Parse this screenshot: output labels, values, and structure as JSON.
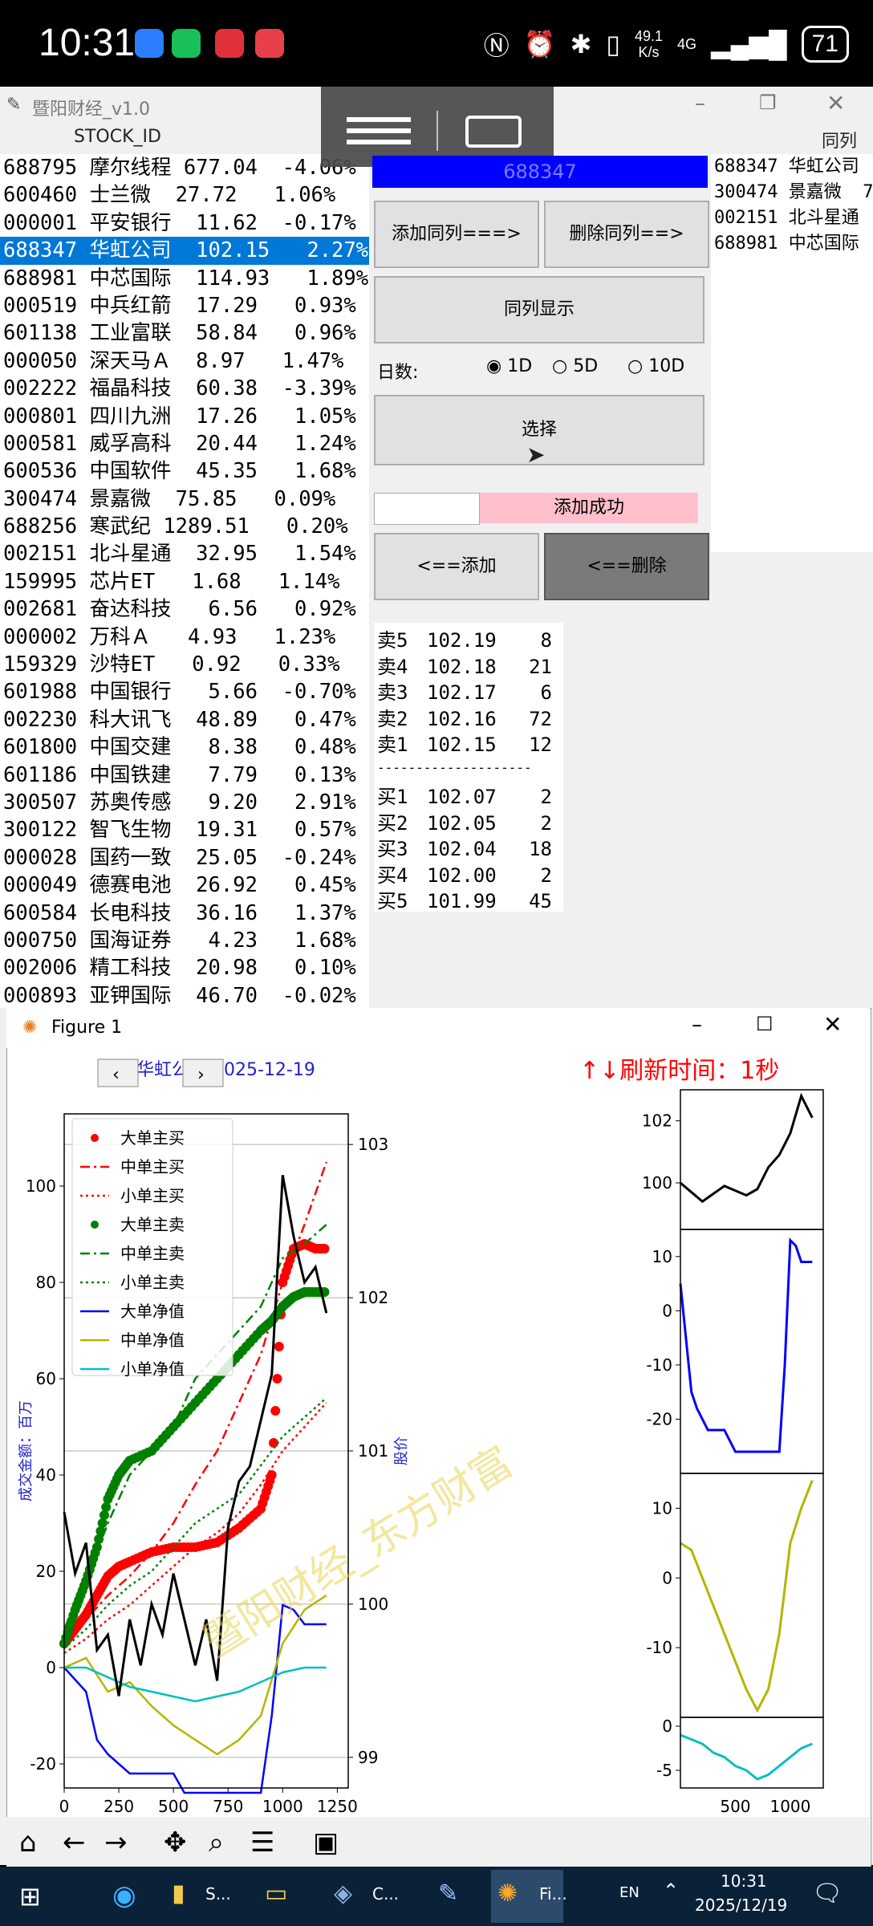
{
  "status_bar": {
    "time": "10:31",
    "net_speed_value": "49.1",
    "net_speed_unit": "K/s",
    "network_type": "4G",
    "battery": "71"
  },
  "app_window": {
    "title": "暨阳财经_v1.0",
    "col_stock_id": "STOCK_ID",
    "col_peer": "同列列"
  },
  "stock_list": [
    {
      "text": "688795 摩尔线程 677.04  -4.06%"
    },
    {
      "text": "600460 士兰微  27.72   1.06%"
    },
    {
      "text": "000001 平安银行  11.62  -0.17%"
    },
    {
      "text": "688347 华虹公司  102.15   2.27%"
    },
    {
      "text": "688981 中芯国际  114.93   1.89%"
    },
    {
      "text": "000519 中兵红箭  17.29   0.93%"
    },
    {
      "text": "601138 工业富联  58.84   0.96%"
    },
    {
      "text": "000050 深天马Ａ  8.97   1.47%"
    },
    {
      "text": "002222 福晶科技  60.38  -3.39%"
    },
    {
      "text": "000801 四川九洲  17.26   1.05%"
    },
    {
      "text": "000581 威孚高科  20.44   1.24%"
    },
    {
      "text": "600536 中国软件  45.35   1.68%"
    },
    {
      "text": "300474 景嘉微  75.85   0.09%"
    },
    {
      "text": "688256 寒武纪 1289.51   0.20%"
    },
    {
      "text": "002151 北斗星通  32.95   1.54%"
    },
    {
      "text": "159995 芯片ET   1.68   1.14%"
    },
    {
      "text": "002681 奋达科技   6.56   0.92%"
    },
    {
      "text": "000002 万科Ａ   4.93   1.23%"
    },
    {
      "text": "159329 沙特ET   0.92   0.33%"
    },
    {
      "text": "601988 中国银行   5.66  -0.70%"
    },
    {
      "text": "002230 科大讯飞  48.89   0.47%"
    },
    {
      "text": "601800 中国交建   8.38   0.48%"
    },
    {
      "text": "601186 中国铁建   7.79   0.13%"
    },
    {
      "text": "300507 苏奥传感   9.20   2.91%"
    },
    {
      "text": "300122 智飞生物  19.31   0.57%"
    },
    {
      "text": "000028 国药一致  25.05  -0.24%"
    },
    {
      "text": "000049 德赛电池  26.92   0.45%"
    },
    {
      "text": "600584 长电科技  36.16   1.37%"
    },
    {
      "text": "000750 国海证券   4.23   1.68%"
    },
    {
      "text": "002006 精工科技  20.98   0.10%"
    },
    {
      "text": "000893 亚钾国际  46.70  -0.02%"
    }
  ],
  "controls": {
    "code": "688347",
    "add_peer": "添加同列===>",
    "del_peer": "删除同列==>",
    "show_peer": "同列显示",
    "days_label": "日数:",
    "opt_1d": "1D",
    "opt_5d": "5D",
    "opt_10d": "10D",
    "select": "选择",
    "status": "添加成功",
    "add": "<==添加",
    "delete": "<==删除"
  },
  "peer_list": [
    "688347 华虹公司",
    "300474 景嘉微  7",
    "002151 北斗星通",
    "688981 中芯国际"
  ],
  "order_book": {
    "asks": [
      {
        "label": "卖5",
        "price": "102.19",
        "vol": "8"
      },
      {
        "label": "卖4",
        "price": "102.18",
        "vol": "21"
      },
      {
        "label": "卖3",
        "price": "102.17",
        "vol": "6"
      },
      {
        "label": "卖2",
        "price": "102.16",
        "vol": "72"
      },
      {
        "label": "卖1",
        "price": "102.15",
        "vol": "12"
      }
    ],
    "divider": "--------------------",
    "bids": [
      {
        "label": "买1",
        "price": "102.07",
        "vol": "2"
      },
      {
        "label": "买2",
        "price": "102.05",
        "vol": "2"
      },
      {
        "label": "买3",
        "price": "102.04",
        "vol": "18"
      },
      {
        "label": "买4",
        "price": "102.00",
        "vol": "2"
      },
      {
        "label": "买5",
        "price": "101.99",
        "vol": "45"
      }
    ]
  },
  "figure": {
    "window_title": "Figure 1",
    "chart_title": "华虹公司  2025-12-19",
    "refresh": "↑↓刷新时间：1秒",
    "watermark": "暨阳财经_东方财富"
  },
  "chart_data": [
    {
      "type": "line",
      "title": "华虹公司  2025-12-19",
      "ylabel": "成交金额：百万",
      "y2label": "股价",
      "xlim": [
        0,
        1300
      ],
      "ylim": [
        -25,
        115
      ],
      "y2lim": [
        98.8,
        103.2
      ],
      "xticks": [
        "0",
        "250",
        "500",
        "750",
        "1000",
        "1250"
      ],
      "yticks": [
        "-20",
        "0",
        "20",
        "40",
        "60",
        "80",
        "100"
      ],
      "y2ticks": [
        "99",
        "100",
        "101",
        "102",
        "103"
      ],
      "legend_placement": "top-left",
      "grid": "horizontal on price axis",
      "series": [
        {
          "name": "大单主买",
          "color": "#ff0000",
          "style": "dots",
          "x": [
            0,
            50,
            100,
            150,
            200,
            250,
            300,
            400,
            500,
            600,
            700,
            800,
            900,
            950,
            1000,
            1050,
            1100,
            1150,
            1200
          ],
          "values": [
            5,
            8,
            11,
            15,
            19,
            21,
            22,
            24,
            25,
            25,
            26,
            29,
            33,
            40,
            80,
            87,
            88,
            87,
            87
          ]
        },
        {
          "name": "中单主买",
          "color": "#ff0000",
          "style": "dashdot",
          "x": [
            0,
            100,
            200,
            300,
            400,
            500,
            600,
            700,
            800,
            900,
            1000,
            1100,
            1200
          ],
          "values": [
            5,
            10,
            15,
            19,
            24,
            30,
            38,
            45,
            55,
            65,
            80,
            92,
            105
          ]
        },
        {
          "name": "小单主买",
          "color": "#ff0000",
          "style": "dotted",
          "x": [
            0,
            100,
            200,
            300,
            400,
            500,
            600,
            700,
            800,
            900,
            1000,
            1100,
            1200
          ],
          "values": [
            3,
            6,
            10,
            13,
            17,
            21,
            25,
            28,
            32,
            38,
            45,
            50,
            55
          ]
        },
        {
          "name": "大单主卖",
          "color": "#008000",
          "style": "dots",
          "x": [
            0,
            50,
            100,
            150,
            200,
            250,
            300,
            400,
            500,
            600,
            700,
            800,
            900,
            950,
            1000,
            1050,
            1100,
            1150,
            1200
          ],
          "values": [
            5,
            12,
            18,
            25,
            35,
            40,
            43,
            45,
            50,
            55,
            60,
            65,
            70,
            72,
            75,
            77,
            78,
            78,
            78
          ]
        },
        {
          "name": "中单主卖",
          "color": "#008000",
          "style": "dashdot",
          "x": [
            0,
            100,
            200,
            300,
            400,
            500,
            600,
            700,
            800,
            900,
            1000,
            1100,
            1200
          ],
          "values": [
            8,
            18,
            30,
            40,
            45,
            50,
            60,
            65,
            70,
            75,
            85,
            88,
            92
          ]
        },
        {
          "name": "小单主卖",
          "color": "#008000",
          "style": "dotted",
          "x": [
            0,
            100,
            200,
            300,
            400,
            500,
            600,
            700,
            800,
            900,
            1000,
            1100,
            1200
          ],
          "values": [
            4,
            8,
            13,
            17,
            20,
            25,
            30,
            33,
            36,
            42,
            48,
            52,
            56
          ]
        },
        {
          "name": "大单净值",
          "color": "#0000ff",
          "style": "solid",
          "x": [
            0,
            100,
            150,
            200,
            250,
            300,
            400,
            500,
            550,
            600,
            700,
            800,
            900,
            950,
            1000,
            1050,
            1100,
            1150,
            1200
          ],
          "values": [
            0,
            -5,
            -15,
            -18,
            -20,
            -22,
            -22,
            -22,
            -26,
            -26,
            -26,
            -26,
            -26,
            -10,
            13,
            12,
            9,
            9,
            9
          ]
        },
        {
          "name": "中单净值",
          "color": "#b5b500",
          "style": "solid",
          "x": [
            0,
            100,
            200,
            300,
            400,
            500,
            600,
            700,
            800,
            900,
            1000,
            1100,
            1200
          ],
          "values": [
            0,
            2,
            -5,
            -3,
            -8,
            -12,
            -15,
            -18,
            -15,
            -10,
            5,
            12,
            15
          ]
        },
        {
          "name": "小单净值",
          "color": "#00bfbf",
          "style": "solid",
          "x": [
            0,
            100,
            200,
            300,
            400,
            500,
            600,
            700,
            800,
            900,
            1000,
            1100,
            1200
          ],
          "values": [
            0,
            0,
            -2,
            -4,
            -5,
            -6,
            -7,
            -6,
            -5,
            -3,
            -1,
            0,
            0
          ]
        },
        {
          "name": "price",
          "axis": "right",
          "color": "#000000",
          "style": "solid",
          "x": [
            0,
            50,
            100,
            150,
            200,
            250,
            300,
            350,
            400,
            450,
            500,
            550,
            600,
            650,
            700,
            750,
            800,
            850,
            900,
            950,
            1000,
            1050,
            1100,
            1150,
            1200
          ],
          "values": [
            100.6,
            100.2,
            100.4,
            99.7,
            99.8,
            99.4,
            99.9,
            99.6,
            100.0,
            99.8,
            100.2,
            99.9,
            99.6,
            99.9,
            99.5,
            100.5,
            100.8,
            100.9,
            101.2,
            101.5,
            102.8,
            102.4,
            102.1,
            102.2,
            101.9
          ]
        }
      ]
    },
    {
      "type": "line",
      "title": "",
      "xlim": [
        0,
        1300
      ],
      "ylim": [
        98.5,
        103
      ],
      "yticks": [
        "100",
        "102"
      ],
      "series": [
        {
          "name": "",
          "color": "#000000",
          "x": [
            0,
            200,
            400,
            600,
            700,
            800,
            900,
            1000,
            1100,
            1200
          ],
          "values": [
            100,
            99.4,
            99.9,
            99.6,
            99.8,
            100.5,
            100.9,
            101.6,
            102.8,
            102.1
          ]
        }
      ]
    },
    {
      "type": "line",
      "title": "",
      "xlim": [
        0,
        1300
      ],
      "ylim": [
        -30,
        15
      ],
      "yticks": [
        "10",
        "0",
        "-10",
        "-20"
      ],
      "series": [
        {
          "name": "",
          "color": "#0000ff",
          "x": [
            0,
            50,
            100,
            150,
            200,
            250,
            300,
            400,
            500,
            600,
            700,
            800,
            900,
            950,
            1000,
            1050,
            1100,
            1150,
            1200
          ],
          "values": [
            5,
            -5,
            -15,
            -18,
            -20,
            -22,
            -22,
            -22,
            -26,
            -26,
            -26,
            -26,
            -26,
            -10,
            13,
            12,
            9,
            9,
            9
          ]
        }
      ]
    },
    {
      "type": "line",
      "title": "",
      "xlim": [
        0,
        1300
      ],
      "ylim": [
        -20,
        15
      ],
      "yticks": [
        "10",
        "0",
        "-10"
      ],
      "series": [
        {
          "name": "",
          "color": "#b5b500",
          "x": [
            0,
            100,
            200,
            300,
            400,
            500,
            600,
            700,
            800,
            900,
            1000,
            1100,
            1200
          ],
          "values": [
            5,
            4,
            0,
            -4,
            -8,
            -12,
            -16,
            -19,
            -16,
            -8,
            5,
            10,
            14
          ]
        }
      ]
    },
    {
      "type": "line",
      "title": "",
      "xlim": [
        0,
        1300
      ],
      "xticks": [
        "500",
        "1000"
      ],
      "ylim": [
        -7,
        1
      ],
      "yticks": [
        "0",
        "-5"
      ],
      "series": [
        {
          "name": "",
          "color": "#00bfbf",
          "x": [
            0,
            100,
            200,
            300,
            400,
            500,
            600,
            700,
            800,
            900,
            1000,
            1100,
            1200
          ],
          "values": [
            -1,
            -1.5,
            -2,
            -3,
            -3.5,
            -4.5,
            -5,
            -6,
            -5.5,
            -4.5,
            -3.5,
            -2.5,
            -2
          ]
        }
      ]
    }
  ],
  "taskbar": {
    "time": "10:31",
    "date": "2025/12/19",
    "lang": "EN",
    "app1": "S...",
    "app2": "C...",
    "app3": "Fi..."
  }
}
